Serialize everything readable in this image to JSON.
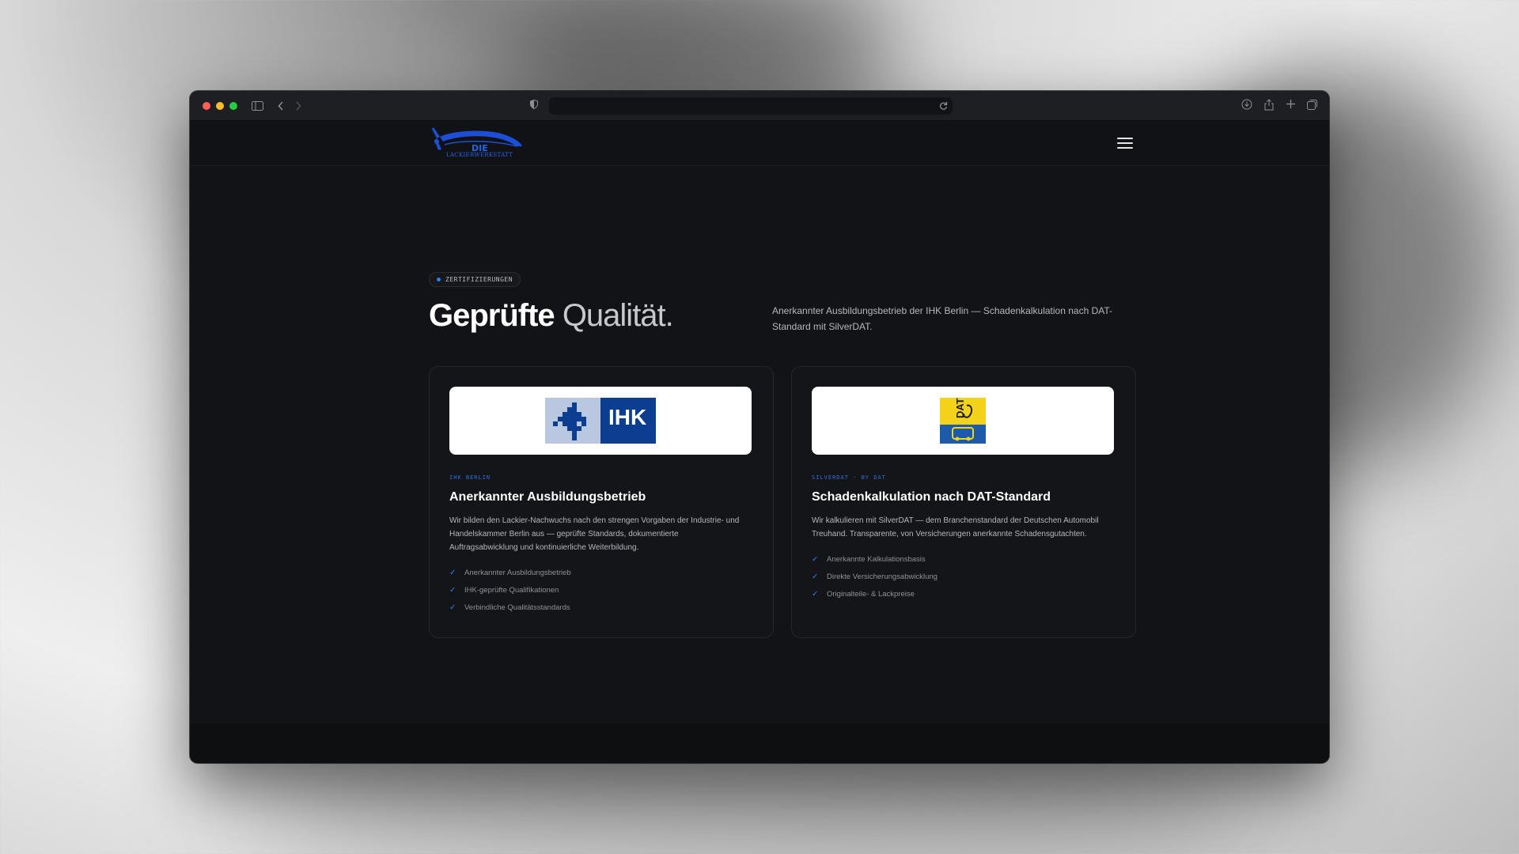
{
  "browser": {
    "address": ""
  },
  "site": {
    "logo_text": "DIE",
    "logo_subtext": "LACKIERWERKSTATT"
  },
  "section": {
    "badge": "ZERTIFIZIERUNGEN",
    "headline_bold": "Geprüfte",
    "headline_light": "Qualität.",
    "intro": "Anerkannter Ausbildungsbetrieb der IHK Berlin — Schadenkalkulation nach DAT-Standard mit SilverDAT."
  },
  "cards": [
    {
      "logo_label": "IHK",
      "tag": "IHK BERLIN",
      "title": "Anerkannter Ausbildungsbetrieb",
      "description": "Wir bilden den Lackier-Nachwuchs nach den strengen Vorgaben der Industrie- und Handelskammer Berlin aus — geprüfte Standards, dokumentierte Auftragsabwicklung und kontinuierliche Weiterbildung.",
      "checks": [
        "Anerkannter Ausbildungsbetrieb",
        "IHK-geprüfte Qualifikationen",
        "Verbindliche Qualitätsstandards"
      ]
    },
    {
      "logo_label": "DAT",
      "tag": "SILVERDAT · BY DAT",
      "title": "Schadenkalkulation nach DAT-Standard",
      "description": "Wir kalkulieren mit SilverDAT — dem Branchenstandard der Deutschen Automobil Treuhand. Transparente, von Versicherungen anerkannte Schadensgutachten.",
      "checks": [
        "Anerkannte Kalkulationsbasis",
        "Direkte Versicherungsabwicklung",
        "Originalteile- & Lackpreise"
      ]
    }
  ],
  "colors": {
    "accent": "#2f7cf6",
    "background": "#121316",
    "ihk_blue": "#0b3d91",
    "dat_yellow": "#f3d21a"
  }
}
